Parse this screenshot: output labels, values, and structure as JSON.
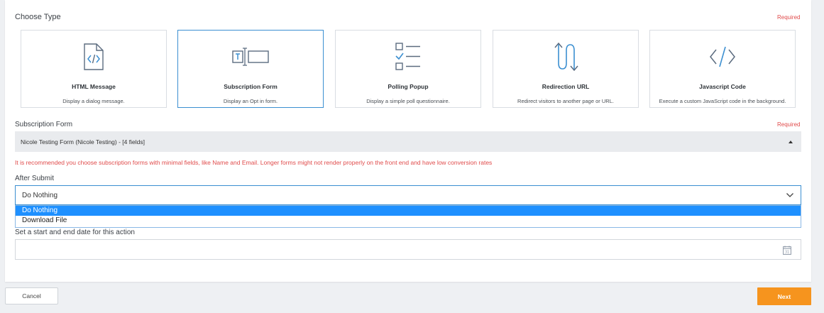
{
  "choose_type": {
    "label": "Choose Type",
    "required": "Required",
    "cards": [
      {
        "title": "HTML Message",
        "desc": "Display a dialog message.",
        "icon": "html-file-icon"
      },
      {
        "title": "Subscription Form",
        "desc": "Display an Opt in form.",
        "icon": "text-input-icon",
        "selected": true
      },
      {
        "title": "Polling Popup",
        "desc": "Display a simple poll questionnaire.",
        "icon": "checklist-icon"
      },
      {
        "title": "Redirection URL",
        "desc": "Redirect visitors to another page or URL.",
        "icon": "redirect-arrows-icon"
      },
      {
        "title": "Javascript Code",
        "desc": "Execute a custom JavaScript code in the background.",
        "icon": "code-brackets-icon"
      }
    ]
  },
  "subscription_form": {
    "label": "Subscription Form",
    "required": "Required",
    "selected_value": "Nicole Testing Form (Nicole Testing) - [4 fields]",
    "warning": "It is recommended you choose subscription forms with minimal fields, like Name and Email. Longer forms might not render properly on the front end and have low conversion rates"
  },
  "after_submit": {
    "label": "After Submit",
    "selected_value": "Do Nothing",
    "options": [
      "Do Nothing",
      "Download File"
    ]
  },
  "schedule": {
    "label": "Set a start and end date for this action",
    "value": "",
    "calendar_day": "31"
  },
  "footer": {
    "cancel_label": "Cancel",
    "next_label": "Next"
  },
  "colors": {
    "accent": "#3b8fd1",
    "required": "#e04b4b",
    "next_button": "#f6941e",
    "highlight": "#1e90ff"
  }
}
